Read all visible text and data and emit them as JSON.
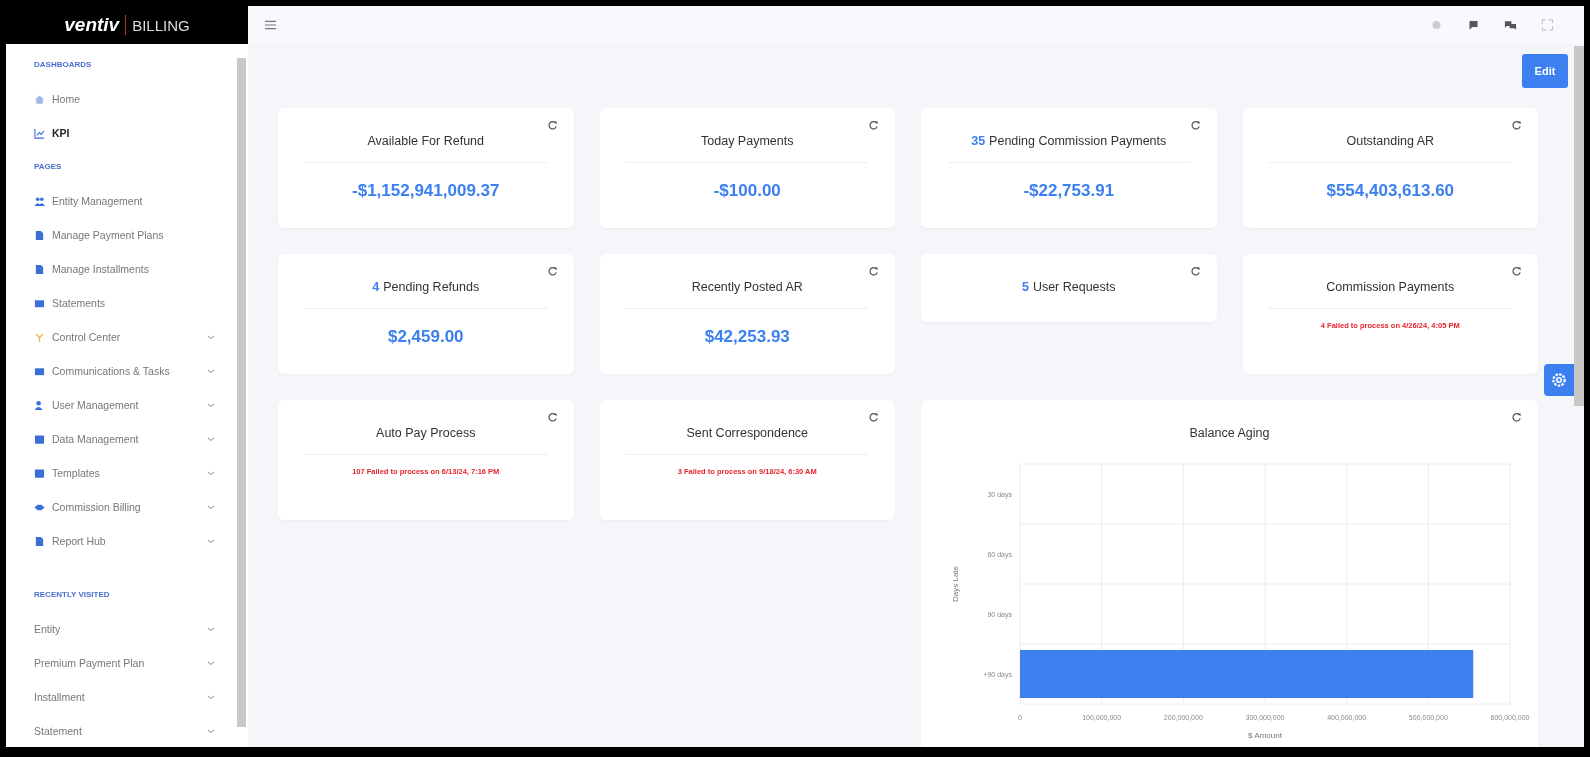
{
  "brand": {
    "name": "ventiv",
    "product": "BILLING"
  },
  "sidebar": {
    "sections": [
      {
        "heading": "DASHBOARDS",
        "items": [
          {
            "label": "Home",
            "selected": false,
            "has_submenu": false
          },
          {
            "label": "KPI",
            "selected": true,
            "has_submenu": false
          }
        ]
      },
      {
        "heading": "PAGES",
        "items": [
          {
            "label": "Entity Management",
            "selected": false,
            "has_submenu": false
          },
          {
            "label": "Manage Payment Plans",
            "selected": false,
            "has_submenu": false
          },
          {
            "label": "Manage Installments",
            "selected": false,
            "has_submenu": false
          },
          {
            "label": "Statements",
            "selected": false,
            "has_submenu": false
          },
          {
            "label": "Control Center",
            "selected": false,
            "has_submenu": true
          },
          {
            "label": "Communications & Tasks",
            "selected": false,
            "has_submenu": true
          },
          {
            "label": "User Management",
            "selected": false,
            "has_submenu": true
          },
          {
            "label": "Data Management",
            "selected": false,
            "has_submenu": true
          },
          {
            "label": "Templates",
            "selected": false,
            "has_submenu": true
          },
          {
            "label": "Commission Billing",
            "selected": false,
            "has_submenu": true
          },
          {
            "label": "Report Hub",
            "selected": false,
            "has_submenu": true
          }
        ]
      },
      {
        "heading": "RECENTLY VISITED",
        "items": [
          {
            "label": "Entity",
            "selected": false,
            "has_submenu": true
          },
          {
            "label": "Premium Payment Plan",
            "selected": false,
            "has_submenu": true
          },
          {
            "label": "Installment",
            "selected": false,
            "has_submenu": true
          },
          {
            "label": "Statement",
            "selected": false,
            "has_submenu": true
          }
        ]
      }
    ]
  },
  "toolbar": {
    "edit_button": "Edit"
  },
  "cards": [
    {
      "kind": "amount",
      "title": "Available For Refund",
      "value": "-$1,152,941,009.37"
    },
    {
      "kind": "amount",
      "title": "Today Payments",
      "value": "-$100.00"
    },
    {
      "kind": "amount",
      "count": "35",
      "title": "Pending Commission Payments",
      "value": "-$22,753.91"
    },
    {
      "kind": "amount",
      "title": "Outstanding AR",
      "value": "$554,403,613.60"
    },
    {
      "kind": "amount",
      "count": "4",
      "title": "Pending Refunds",
      "value": "$2,459.00"
    },
    {
      "kind": "amount",
      "title": "Recently Posted AR",
      "value": "$42,253.93"
    },
    {
      "kind": "plain",
      "count": "5",
      "title": "User Requests"
    },
    {
      "kind": "status",
      "title": "Commission Payments",
      "message": "4 Failed to process on 4/26/24, 4:05 PM"
    },
    {
      "kind": "status",
      "title": "Auto Pay Process",
      "message": "107 Failed to process on 6/13/24, 7:16 PM"
    },
    {
      "kind": "status",
      "title": "Sent Correspondence",
      "message": "3 Failed to process on 9/18/24, 6:30 AM"
    },
    {
      "kind": "chart",
      "title": "Balance Aging",
      "chart_data": {
        "type": "bar",
        "orientation": "horizontal",
        "xlabel": "$ Amount",
        "ylabel": "Days Late",
        "categories": [
          "30 days",
          "60 days",
          "90 days",
          "+90 days"
        ],
        "grid": true,
        "series": [
          {
            "color": "#3b7ff0",
            "values": [
              0,
              0,
              0,
              555000000
            ]
          }
        ],
        "xlim": [
          0,
          600000000
        ],
        "xticks": [
          {
            "value": 0,
            "label": "0"
          },
          {
            "value": 100000000,
            "label": "100,000,000"
          },
          {
            "value": 200000000,
            "label": "200,000,000"
          },
          {
            "value": 300000000,
            "label": "300,000,000"
          },
          {
            "value": 400000000,
            "label": "400,000,000"
          },
          {
            "value": 500000000,
            "label": "500,000,000"
          },
          {
            "value": 600000000,
            "label": "600,000,000"
          }
        ]
      }
    }
  ]
}
